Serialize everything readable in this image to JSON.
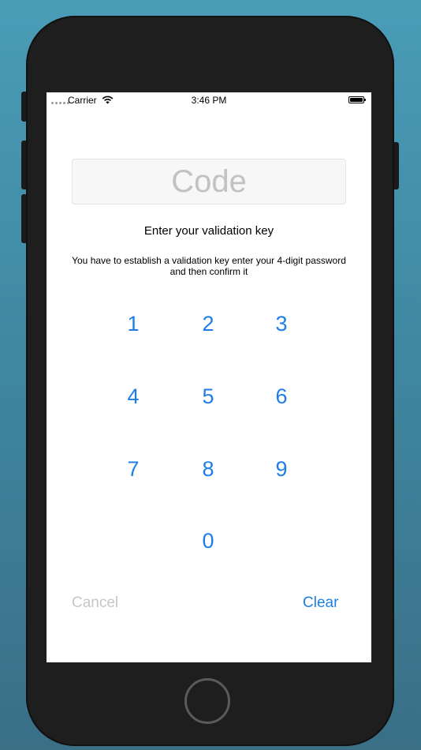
{
  "status_bar": {
    "carrier": "Carrier",
    "time": "3:46 PM"
  },
  "code_field": {
    "placeholder": "Code",
    "value": ""
  },
  "heading": "Enter your validation key",
  "description": "You have to establish a validation key enter your 4-digit password and then confirm it",
  "keypad": {
    "keys": [
      "1",
      "2",
      "3",
      "4",
      "5",
      "6",
      "7",
      "8",
      "9",
      "0"
    ]
  },
  "actions": {
    "cancel_label": "Cancel",
    "clear_label": "Clear"
  },
  "colors": {
    "accent": "#1f7ee6",
    "disabled": "#c6c6c6",
    "background_top": "#4a9cb7",
    "background_bottom": "#3a6f86"
  }
}
